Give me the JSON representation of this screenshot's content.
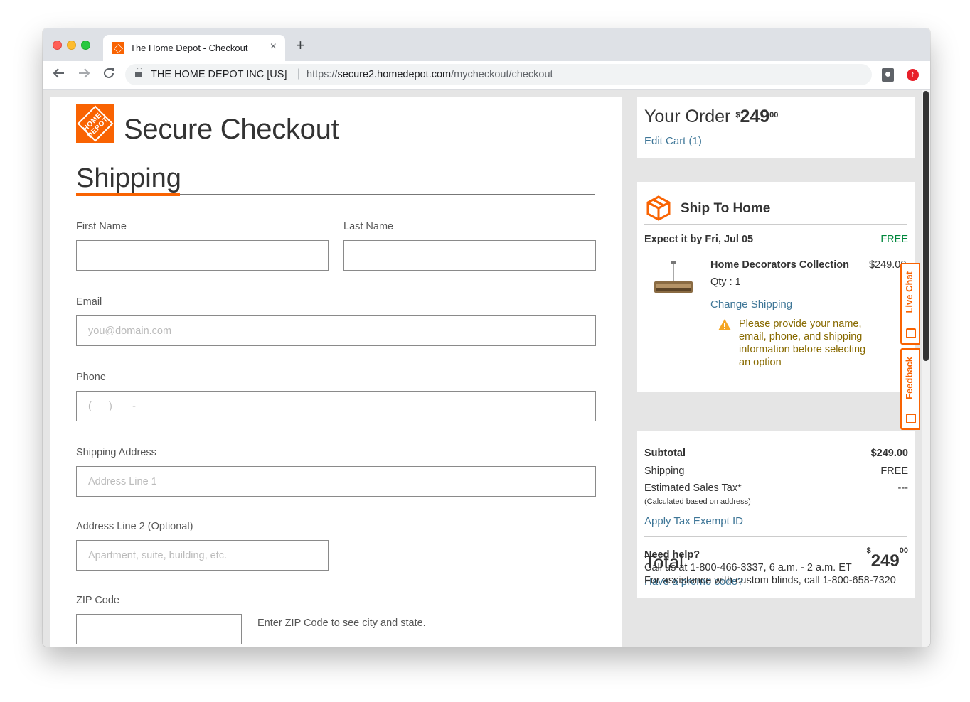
{
  "browser": {
    "tab_title": "The Home Depot - Checkout",
    "close_glyph": "×",
    "newtab_glyph": "+",
    "org": "THE HOME DEPOT INC [US]",
    "url_prefix": "https://",
    "url_host": "secure2.homedepot.com",
    "url_path": "/mycheckout/checkout"
  },
  "checkout": {
    "page_title": "Secure Checkout",
    "section": "Shipping",
    "logo_text": "HOME DEPOT",
    "fields": {
      "first_name": "First Name",
      "last_name": "Last Name",
      "email": "Email",
      "email_placeholder": "you@domain.com",
      "phone": "Phone",
      "phone_placeholder": "(___) ___-____",
      "address": "Shipping Address",
      "address_placeholder": "Address Line 1",
      "address2": "Address Line 2 (Optional)",
      "address2_placeholder": "Apartment, suite, building, etc.",
      "zip": "ZIP Code",
      "zip_hint": "Enter ZIP Code to see city and state."
    }
  },
  "order": {
    "title": "Your Order",
    "amount_sup": "$",
    "amount": "249",
    "amount_cents": "00",
    "edit_cart": "Edit Cart (1)"
  },
  "shipping": {
    "title": "Ship To Home",
    "expect": "Expect it by Fri, Jul 05",
    "expect_cost": "FREE",
    "product_name": "Home Decorators Collection",
    "product_price": "$249.00",
    "qty": "Qty : 1",
    "change": "Change Shipping",
    "warning": "Please provide your name, email, phone, and shipping information before selecting an option"
  },
  "summary": {
    "subtotal_label": "Subtotal",
    "subtotal": "$249.00",
    "shipping_label": "Shipping",
    "shipping": "FREE",
    "tax_label": "Estimated Sales Tax*",
    "tax": "---",
    "tax_note": "(Calculated based on address)",
    "tax_exempt": "Apply Tax Exempt ID",
    "total_label": "Total",
    "total_sup": "$",
    "total": "249",
    "total_cents": "00",
    "promo": "Have a promo code?"
  },
  "help": {
    "title": "Need help?",
    "line1": "Call us at 1-800-466-3337, 6 a.m. - 2 a.m. ET",
    "line2": "For assistance with custom blinds, call 1-800-658-7320"
  },
  "side_tabs": {
    "live_chat": "Live Chat",
    "feedback": "Feedback"
  },
  "colors": {
    "brand_orange": "#f96302",
    "link_blue": "#3e7697",
    "free_green": "#00873c",
    "warning_text": "#886a00"
  }
}
